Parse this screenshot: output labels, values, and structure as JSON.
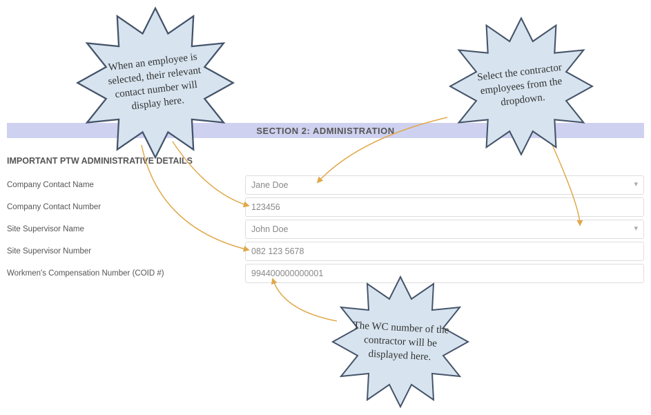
{
  "section": {
    "title": "SECTION 2: ADMINISTRATION",
    "subheading": "IMPORTANT PTW ADMINISTRATIVE DETAILS"
  },
  "fields": {
    "company_contact_name": {
      "label": "Company Contact Name",
      "value": "Jane Doe"
    },
    "company_contact_number": {
      "label": "Company Contact Number",
      "value": "123456"
    },
    "site_supervisor_name": {
      "label": "Site Supervisor Name",
      "value": "John Doe"
    },
    "site_supervisor_number": {
      "label": "Site Supervisor Number",
      "value": "082 123 5678"
    },
    "coid": {
      "label": "Workmen's Compensation Number (COID #)",
      "value": "994400000000001"
    }
  },
  "callouts": {
    "c1": "When an employee is selected, their relevant contact number will display here.",
    "c2": "Select the contractor employees from the dropdown.",
    "c3": "The WC number of the contractor will be displayed here."
  },
  "colors": {
    "band": "#cfd1f0",
    "burst_fill": "#d7e4ef",
    "burst_stroke": "#45546a",
    "arrow": "#e0a84a"
  }
}
